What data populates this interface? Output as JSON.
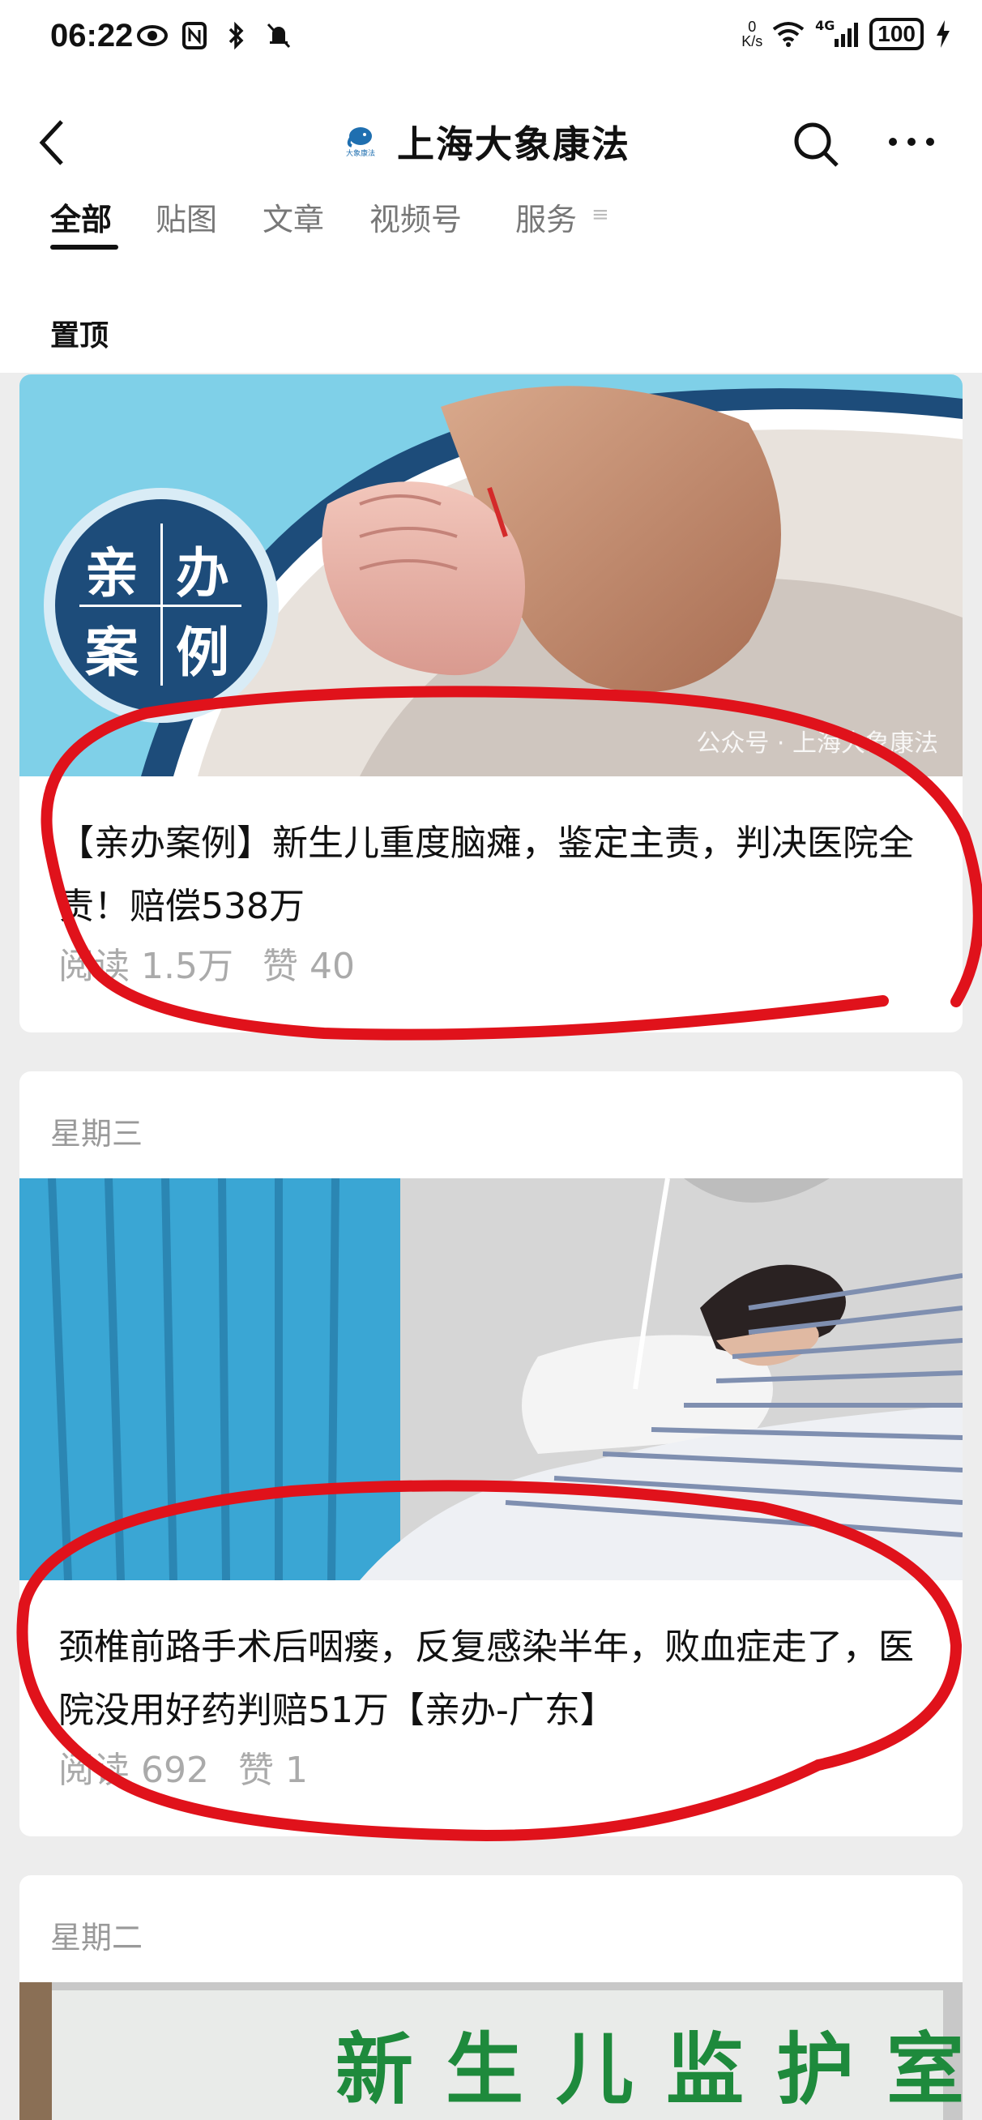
{
  "status_bar": {
    "time": "06:22",
    "net_speed_top": "0",
    "net_speed_unit": "K/s",
    "signal_label": "4G",
    "battery": "100"
  },
  "header": {
    "title": "上海大象康法",
    "logo_text": "大象康法",
    "back_icon": "chevron-left-icon",
    "search_icon": "search-icon",
    "more_icon": "more-dots-icon"
  },
  "tabs": [
    {
      "label": "全部",
      "active": true
    },
    {
      "label": "贴图",
      "active": false
    },
    {
      "label": "文章",
      "active": false
    },
    {
      "label": "视频号",
      "active": false
    },
    {
      "label": "服务",
      "active": false
    }
  ],
  "pinned_label": "置顶",
  "articles": [
    {
      "day": "",
      "badge": [
        "亲",
        "办",
        "案",
        "例"
      ],
      "watermark": "公众号 · 上海大象康法",
      "title": "【亲办案例】新生儿重度脑瘫，鉴定主责，判决医院全责！赔偿538万",
      "reads": "阅读 1.5万",
      "likes": "赞 40"
    },
    {
      "day": "星期三",
      "title": "颈椎前路手术后咽瘘，反复感染半年，败血症走了，医院没用好药判赔51万【亲办-广东】",
      "reads": "阅读 692",
      "likes": "赞 1"
    },
    {
      "day": "星期二",
      "sign_text": "新生儿监护室"
    }
  ],
  "colors": {
    "accent_blue": "#1d4c7a",
    "light_blue": "#7fd0e8",
    "annotation_red": "#e0121b"
  }
}
